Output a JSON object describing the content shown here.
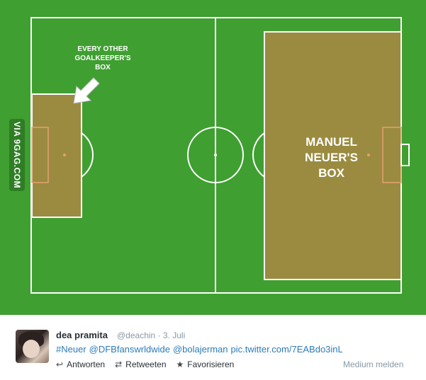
{
  "image": {
    "watermark": "VIA 9GAG.COM",
    "caption_small": "EVERY OTHER\nGOALKEEPER'S\nBOX",
    "caption_big": "MANUEL\nNEUER'S\nBOX"
  },
  "colors": {
    "grass": "#3f9f31",
    "box_fill": "#9a8b40",
    "lines": "#ffffff",
    "link": "#2b7bb9",
    "muted": "#8899a6"
  },
  "tweet": {
    "name": "dea pramita",
    "handle": "@deachin",
    "separator": "·",
    "date": "3. Juli",
    "text_parts": [
      "#Neuer",
      "@DFBfanswrldwide",
      "@bolajerman",
      "pic.twitter.com/7EABdo3inL"
    ],
    "actions": [
      {
        "icon": "reply-icon",
        "label": "Antworten"
      },
      {
        "icon": "retweet-icon",
        "label": "Retweeten"
      },
      {
        "icon": "star-icon",
        "label": "Favorisieren"
      }
    ],
    "report_label": "Medium melden"
  }
}
